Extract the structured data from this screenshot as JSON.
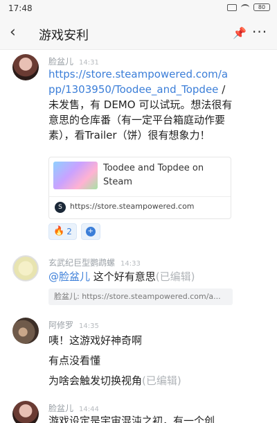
{
  "status_bar": {
    "time": "17:48",
    "battery": "80"
  },
  "header": {
    "title": "游戏安利",
    "back_icon": "back-arrow",
    "pin_icon": "pin-icon",
    "more_icon": "more-icon"
  },
  "messages": [
    {
      "author": "脸盆儿",
      "time": "14:31",
      "link_text": "https://store.steampowered.com/app/1303950/Toodee_and_Topdee",
      "text": "/ 未发售，有 DEMO 可以试玩。想法很有意思的仓库番（有一定平台箱庭动作要素），看Trailer（饼）很有想象力！",
      "card": {
        "title": "Toodee and Topdee on Steam",
        "source": "https://store.steampowered.com"
      },
      "reactions": [
        {
          "icon": "fire-icon",
          "count": "2"
        }
      ]
    },
    {
      "author": "玄武纪巨型鹦鹉螺",
      "time": "14:33",
      "mention": "@脸盆儿",
      "text": " 这个好有意思",
      "edited": "(已编辑)",
      "quote": "脸盆儿: https://store.steampowered.com/a..."
    },
    {
      "author": "阿修罗",
      "time": "14:35",
      "lines": [
        "咦！这游戏好神奇啊",
        "有点没看懂",
        "为啥会触发切换视角"
      ],
      "edited": "(已编辑)"
    },
    {
      "author": "脸盆儿",
      "time": "14:44",
      "text": "游戏设定是宇宙混沌之初，有一个创"
    }
  ]
}
